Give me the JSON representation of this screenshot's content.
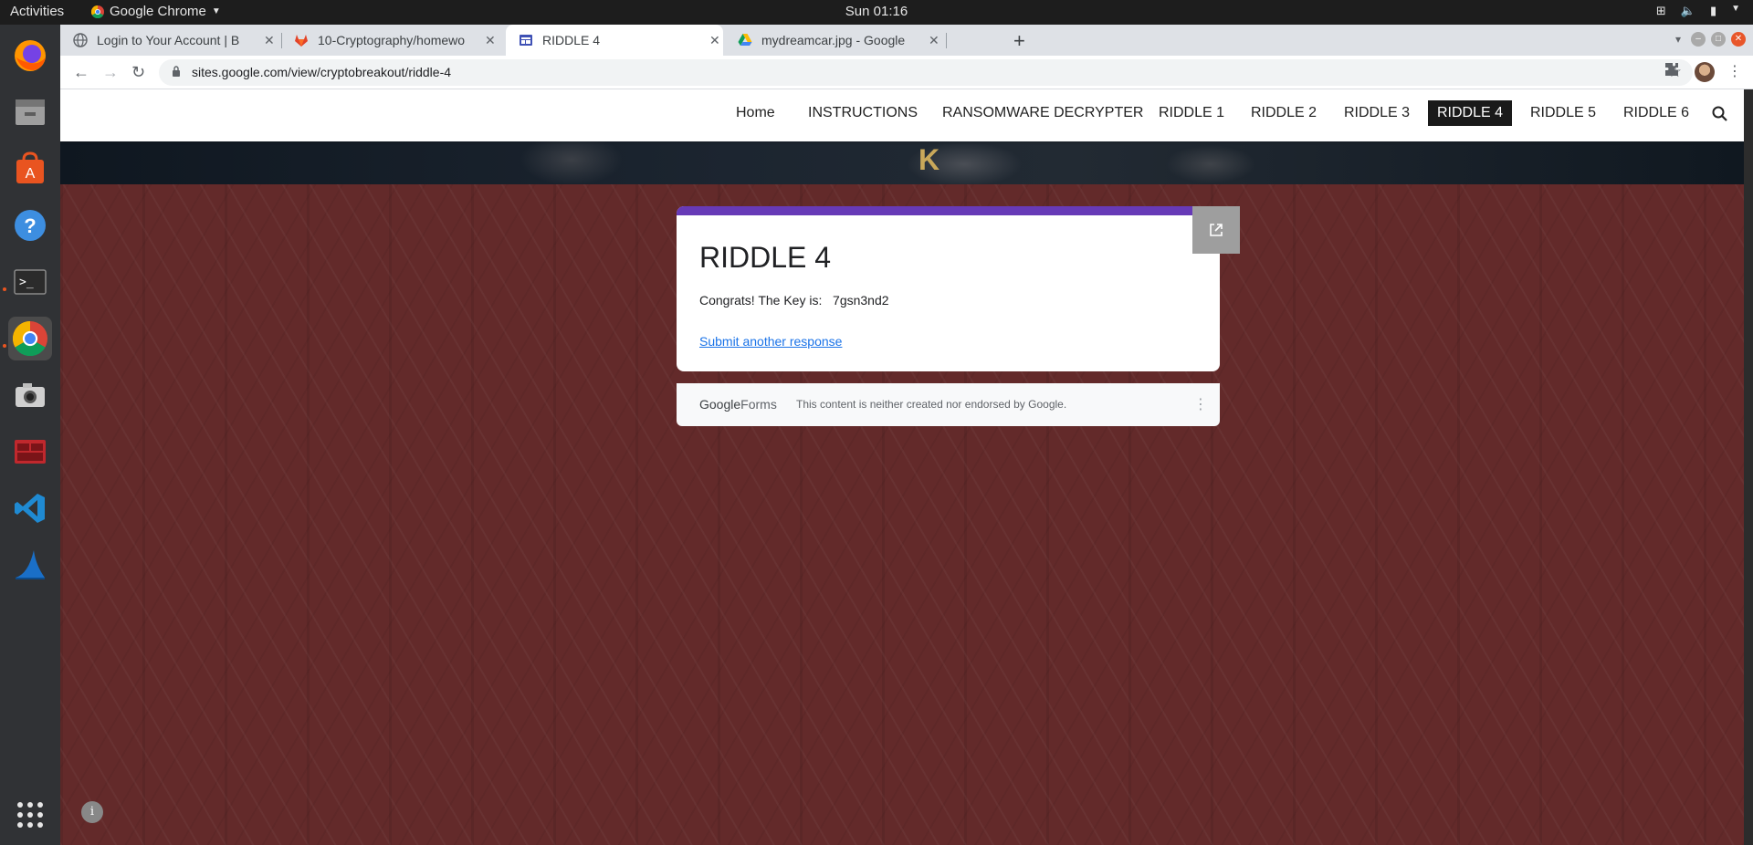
{
  "topbar": {
    "activities": "Activities",
    "app_name": "Google Chrome",
    "clock": "Sun 01:16"
  },
  "dock": {
    "items": [
      "firefox-icon",
      "files-icon",
      "software-center-icon",
      "help-icon",
      "terminal-icon",
      "chrome-icon",
      "screenshot-icon",
      "remote-desktop-icon",
      "vscode-icon",
      "wireshark-icon"
    ],
    "active": "chrome-icon",
    "apps_grid": "show-apps-icon"
  },
  "tabs": [
    {
      "title": "Login to Your Account | B",
      "favicon": "globe-icon"
    },
    {
      "title": "10-Cryptography/homewo",
      "favicon": "gitlab-icon"
    },
    {
      "title": "RIDDLE 4",
      "favicon": "google-sites-icon",
      "active": true
    },
    {
      "title": "mydreamcar.jpg - Google",
      "favicon": "google-drive-icon"
    }
  ],
  "address_bar": {
    "url": "sites.google.com/view/cryptobreakout/riddle-4"
  },
  "site": {
    "nav": [
      "Home",
      "INSTRUCTIONS",
      "RANSOMWARE DECRYPTER",
      "RIDDLE 1",
      "RIDDLE 2",
      "RIDDLE 3",
      "RIDDLE 4",
      "RIDDLE 5",
      "RIDDLE 6"
    ],
    "active_nav": "RIDDLE 4",
    "banner_letter": "K"
  },
  "form": {
    "title": "RIDDLE 4",
    "message": "Congrats! The Key is:   7gsn3nd2",
    "link": "Submit another response",
    "footer_brand_a": "Google",
    "footer_brand_b": "Forms",
    "footer_disclaimer": "This content is neither created nor endorsed by Google.",
    "accent_color": "#673ab7"
  },
  "colors": {
    "page_background": "#632a2a",
    "active_nav_bg": "#1a1a1a"
  }
}
